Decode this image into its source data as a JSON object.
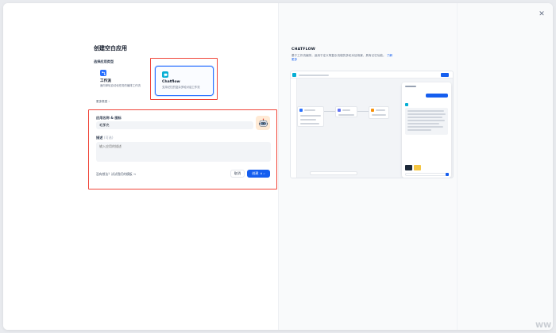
{
  "modal": {
    "title": "创建空白应用",
    "close_icon": "close-icon"
  },
  "app_type": {
    "section_label": "选择应用类型",
    "cards": [
      {
        "name": "工作流",
        "desc": "面向单轮自动化任务的编排工作流",
        "icon": "workflow-icon",
        "selected": false
      },
      {
        "name": "Chatflow",
        "desc": "支持记忆的复杂多轮对话工作流",
        "icon": "chatflow-icon",
        "selected": true
      }
    ],
    "more_label": "更多类型 ›"
  },
  "form": {
    "name_label": "应用名称 & 图标",
    "name_value": "毛那克",
    "desc_label": "描述",
    "desc_optional": "(可选)",
    "desc_placeholder": "输入应用的描述",
    "footer_link": "没有想法？试试我们的模板 →",
    "cancel_label": "取消",
    "create_label": "创建",
    "create_kbd": "⌘ ↵"
  },
  "preview_panel": {
    "title": "CHATFLOW",
    "desc": "基于工作流编排，适用于定义等复杂流程的多轮对话场景，具有记忆功能。",
    "learn_more": "了解更多"
  },
  "watermark": "WW",
  "colors": {
    "accent": "#155eef",
    "highlight": "#f04438",
    "workflow_icon": "#2970ff",
    "chatflow_icon": "#06aed4"
  }
}
